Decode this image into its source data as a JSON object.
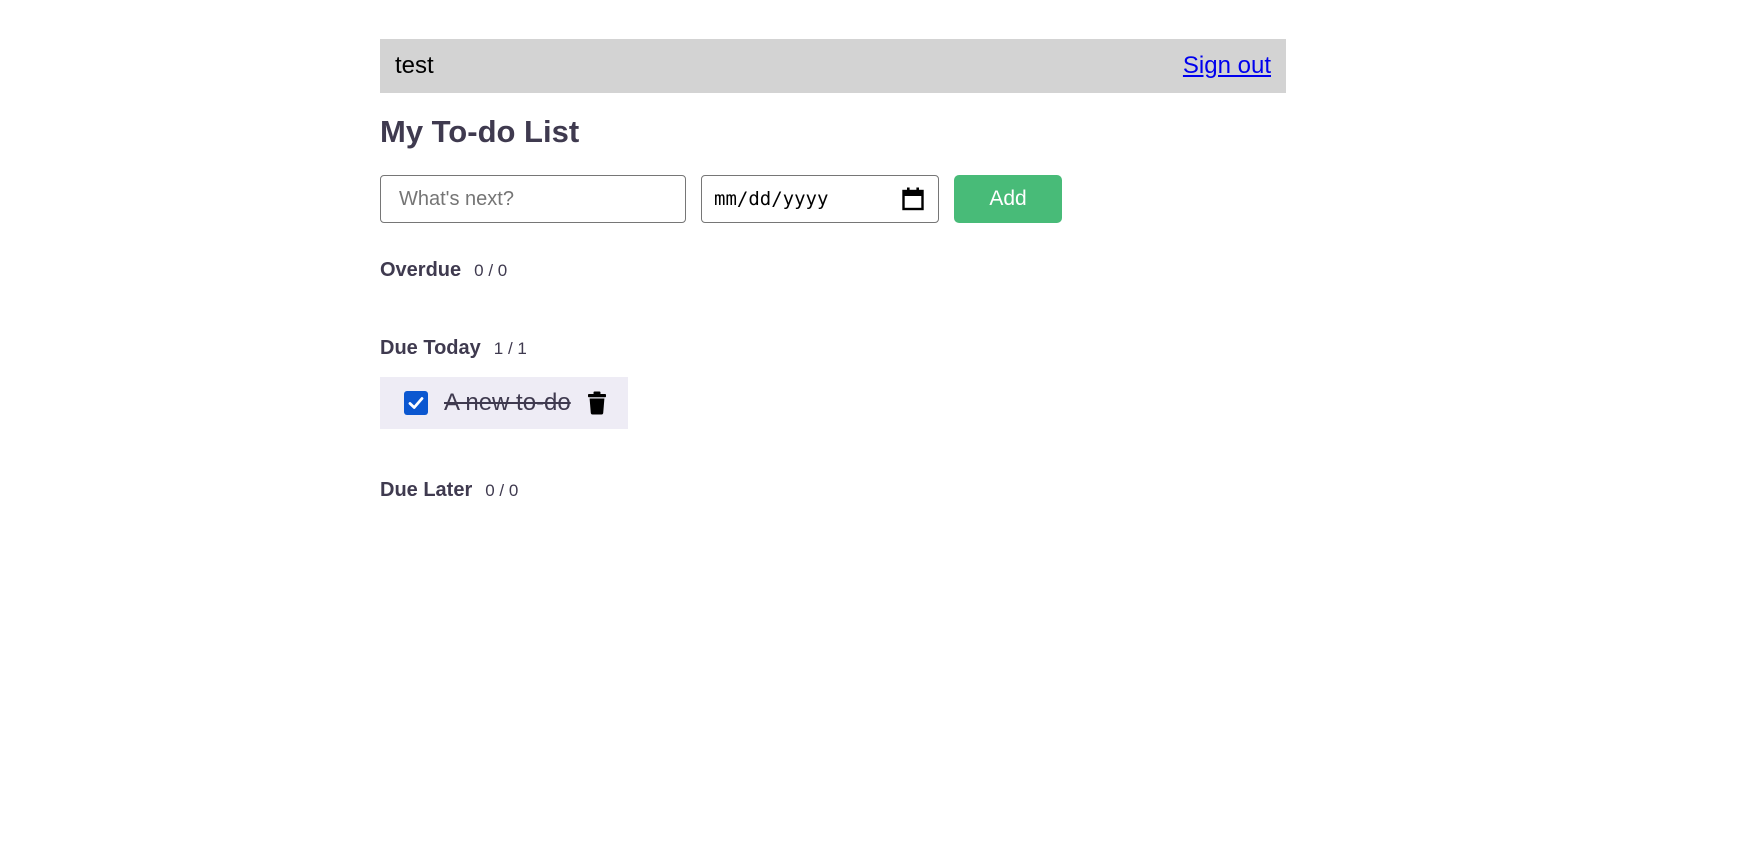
{
  "header": {
    "username": "test",
    "signout_label": "Sign out"
  },
  "page": {
    "title": "My To-do List"
  },
  "form": {
    "todo_placeholder": "What's next?",
    "todo_value": "",
    "date_placeholder": "mm/dd/yyyy",
    "add_label": "Add"
  },
  "sections": {
    "overdue": {
      "title": "Overdue",
      "count": "0 / 0"
    },
    "due_today": {
      "title": "Due Today",
      "count": "1 / 1",
      "items": [
        {
          "text": "A new to-do",
          "completed": true
        }
      ]
    },
    "due_later": {
      "title": "Due Later",
      "count": "0 / 0"
    }
  },
  "icons": {
    "calendar": "calendar-icon",
    "trash": "trash-icon",
    "check": "checkmark-icon"
  },
  "colors": {
    "topbar_bg": "#d3d3d3",
    "link": "#0000ee",
    "add_button": "#48bb78",
    "checkbox": "#0b57d0",
    "item_bg": "#eeecf5",
    "heading_text": "#3f3a4f"
  }
}
